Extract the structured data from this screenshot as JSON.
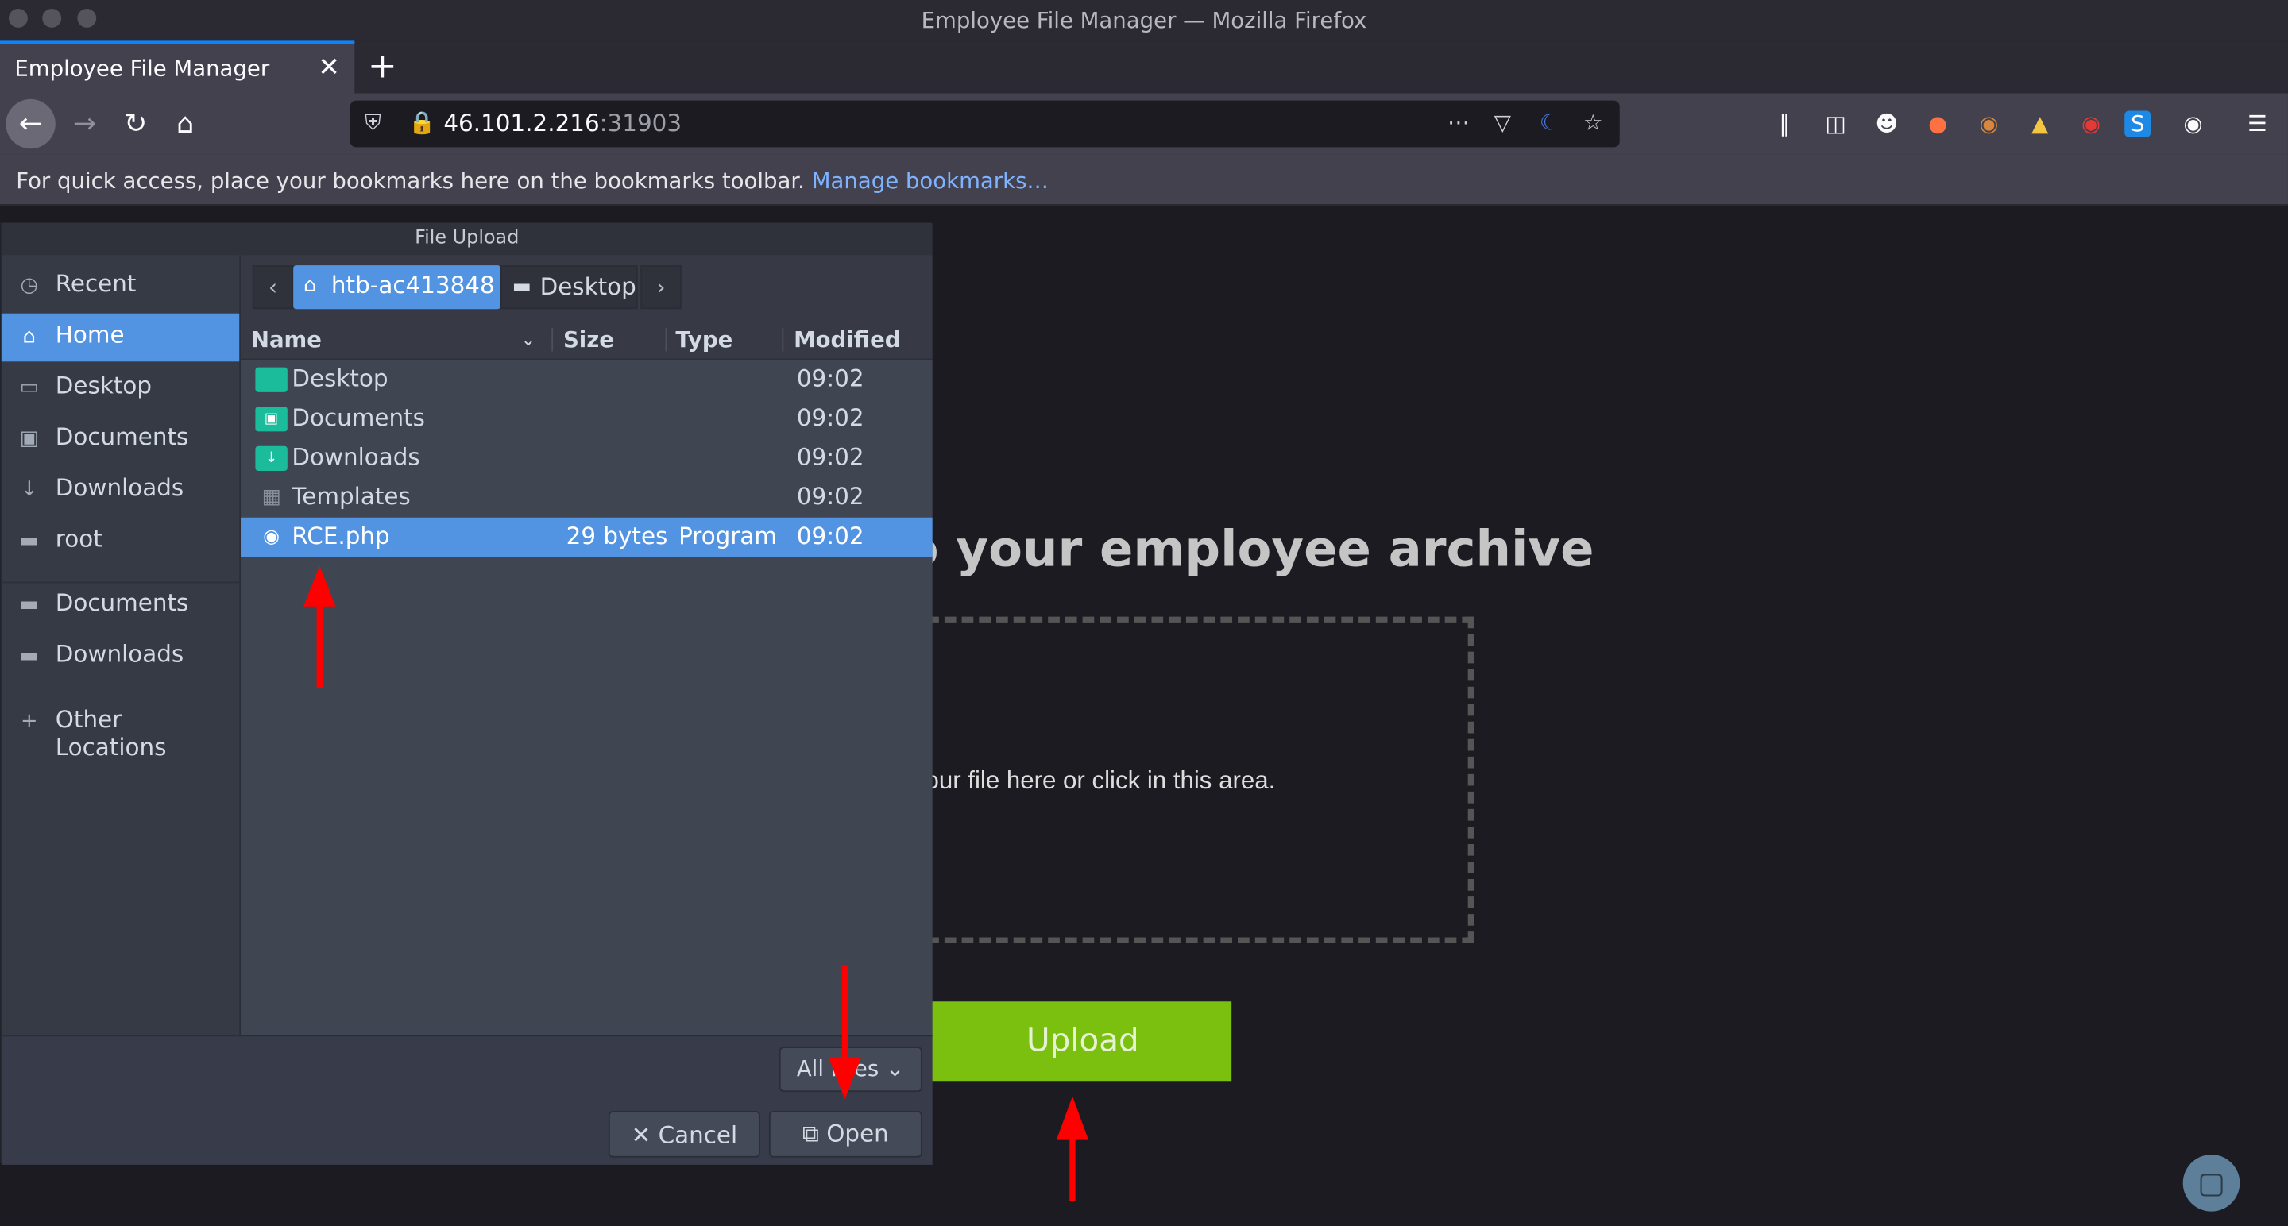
{
  "window": {
    "title": "Employee File Manager — Mozilla Firefox"
  },
  "tab": {
    "label": "Employee File Manager",
    "close": "✕",
    "new_tab": "+"
  },
  "urlbar": {
    "host": "46.101.2.216",
    "port": ":31903"
  },
  "bookmarks_bar": {
    "text": "For quick access, place your bookmarks here on the bookmarks toolbar.",
    "link": "Manage bookmarks…"
  },
  "page": {
    "heading": "o your employee archive",
    "drop_text": "our file here or click in this area.",
    "upload_label": "Upload"
  },
  "dialog": {
    "title": "File Upload",
    "sidebar": {
      "items": [
        {
          "label": "Recent",
          "icon": "clock-icon"
        },
        {
          "label": "Home",
          "icon": "home-icon"
        },
        {
          "label": "Desktop",
          "icon": "desktop-icon"
        },
        {
          "label": "Documents",
          "icon": "document-icon"
        },
        {
          "label": "Downloads",
          "icon": "download-icon"
        },
        {
          "label": "root",
          "icon": "folder-icon"
        },
        {
          "label": "Documents",
          "icon": "folder-icon"
        },
        {
          "label": "Downloads",
          "icon": "folder-icon"
        },
        {
          "label": "Other Locations",
          "icon": "plus-icon"
        }
      ]
    },
    "breadcrumb": {
      "home": "htb-ac413848",
      "current": "Desktop"
    },
    "columns": {
      "name": "Name",
      "size": "Size",
      "type": "Type",
      "modified": "Modified"
    },
    "files": [
      {
        "name": "Desktop",
        "size": "",
        "type": "",
        "modified": "09:02"
      },
      {
        "name": "Documents",
        "size": "",
        "type": "",
        "modified": "09:02"
      },
      {
        "name": "Downloads",
        "size": "",
        "type": "",
        "modified": "09:02"
      },
      {
        "name": "Templates",
        "size": "",
        "type": "",
        "modified": "09:02"
      },
      {
        "name": "RCE.php",
        "size": "29 bytes",
        "type": "Program",
        "modified": "09:02"
      }
    ],
    "filter_label": "All Files",
    "cancel_label": "Cancel",
    "open_label": "Open"
  },
  "colors": {
    "accent": "#5294e2",
    "upload_green": "#7bbf0f",
    "annotation_red": "#ff0000"
  }
}
